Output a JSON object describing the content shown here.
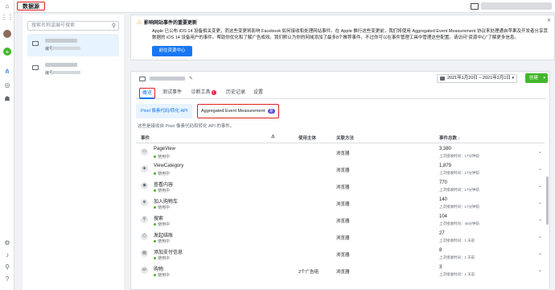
{
  "header": {
    "title": "数据源"
  },
  "rail": {
    "icons": [
      "home-icon",
      "grid-icon",
      "avatar",
      "add-icon",
      "data-sources-icon",
      "settings-icon",
      "help-icon"
    ]
  },
  "sidebar": {
    "search_placeholder": "搜索名称或编号搜索",
    "items": [
      {
        "id_label": "编号"
      },
      {
        "id_label": "编号"
      }
    ]
  },
  "notice": {
    "title": "影响网站事件的重要更新",
    "body": "Apple 已公布 iOS 14 设备相关变更，而这些变更将影响 Facebook 如何接收和处理网站事件。在 Apple 推行这些变更前，我们将使用 Aggregated Event Measurement 协议来处理通自苹果及开发者分享其数据的 iOS 14 设备用户的事件。帮助你优化和了解广告成效。我们默认为你的网域添加了最多8个推荐事件。不过你可以在事件管理工具中管理这些配置。请访问\"资源中心\"了解更多信息。",
    "button": "前往资源中心"
  },
  "toolbar": {
    "date_range": "2021年1月20日 – 2021年2月1日",
    "create_label": "创建"
  },
  "tabs": {
    "overview": "概览",
    "test_events": "测试事件",
    "diagnostics": "诊断工具",
    "diagnostics_badge": "1",
    "history": "历史记录",
    "settings": "设置"
  },
  "subtabs": {
    "pixel": "Pixel 像素代码/转化 API",
    "aem": "Aggregated Event Measurement",
    "aem_badge": "新"
  },
  "description": "这些是接收自 Pixel 像素代码和转化 API 的事件。",
  "table": {
    "headers": {
      "event": "事件",
      "used_by": "使用主体",
      "method": "关联方法",
      "total": "事件总数 ↓"
    },
    "rows": [
      {
        "name": "PageView",
        "status": "使用中",
        "used_by": "",
        "method": "浏览器",
        "total": "3,380",
        "last": "上次接收时间：17分钟前",
        "icon": "page-icon"
      },
      {
        "name": "ViewCategory",
        "status": "使用中",
        "used_by": "",
        "method": "浏览器",
        "total": "1,879",
        "last": "上次接收时间：17分钟前",
        "icon": "category-icon"
      },
      {
        "name": "查看内容",
        "status": "使用中",
        "used_by": "",
        "method": "浏览器",
        "total": "770",
        "last": "上次接收时间：17分钟前",
        "icon": "eye-icon"
      },
      {
        "name": "加入购物车",
        "status": "使用中",
        "used_by": "",
        "method": "浏览器",
        "total": "140",
        "last": "上次接收时间：17分钟前",
        "icon": "cart-icon"
      },
      {
        "name": "搜索",
        "status": "使用中",
        "used_by": "",
        "method": "浏览器",
        "total": "104",
        "last": "上次接收时间：45分钟前",
        "icon": "search-icon"
      },
      {
        "name": "发起结账",
        "status": "使用中",
        "used_by": "",
        "method": "浏览器",
        "total": "27",
        "last": "上次接收时间：1 天前",
        "icon": "checkout-icon"
      },
      {
        "name": "添加支付信息",
        "status": "使用中",
        "used_by": "",
        "method": "浏览器",
        "total": "8",
        "last": "上次接收时间：1 天前",
        "icon": "payment-icon"
      },
      {
        "name": "购物",
        "status": "使用中",
        "used_by": "2个广告组",
        "method": "浏览器",
        "total": "3",
        "last": "上次接收时间：1 天前",
        "icon": "purchase-icon"
      }
    ]
  }
}
